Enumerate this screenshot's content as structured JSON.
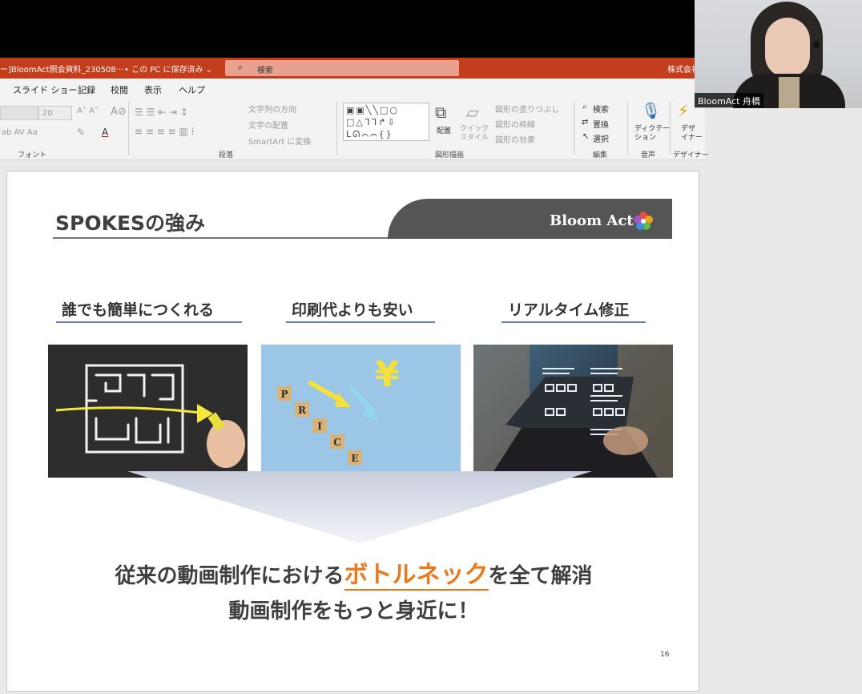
{
  "titlebar": {
    "doc_title": "ー]BloomAct照会資料_230508···",
    "save_status": "• この PC に保存済み ⌄",
    "search_placeholder": "検索",
    "company": "株式会社"
  },
  "menu": [
    "スライド ショー",
    "記録",
    "校閲",
    "表示",
    "ヘルプ"
  ],
  "ribbon": {
    "font_size": "20",
    "group_font": "フォント",
    "group_paragraph": "段落",
    "text_direction": "文字列の方向",
    "text_align": "文字の配置",
    "smartart": "SmartArt に変換",
    "arrange": "配置",
    "quick_styles": "クイック\nスタイル",
    "shape_fill": "図形の塗りつぶし",
    "shape_outline": "図形の枠線",
    "shape_effects": "図形の効果",
    "group_drawing": "図形描画",
    "find": "検索",
    "replace": "置換",
    "select": "選択",
    "group_editing": "編集",
    "dictate": "ディクテー\nション",
    "group_voice": "音声",
    "designer": "デザ\nイナー",
    "group_designer": "デザイナー"
  },
  "webcam": {
    "name": "BloomAct 舟橋"
  },
  "slide": {
    "title": "SPOKESの強み",
    "logo": "Bloom Act",
    "features": [
      "誰でも簡単につくれる",
      "印刷代よりも安い",
      "リアルタイム修正"
    ],
    "price_blocks": [
      "P",
      "R",
      "I",
      "C",
      "E"
    ],
    "yen": "¥",
    "bottleneck_pre": "従来の動画制作における",
    "bottleneck_highlight": "ボトルネック",
    "bottleneck_post": "を全て解消",
    "closer": "動画制作をもっと身近に！",
    "page_number": "16"
  },
  "colors": {
    "titlebar": "#c43e1c",
    "highlight": "#e9791c",
    "feature_underline": "#6b7db3",
    "logo_bar": "#555555"
  }
}
